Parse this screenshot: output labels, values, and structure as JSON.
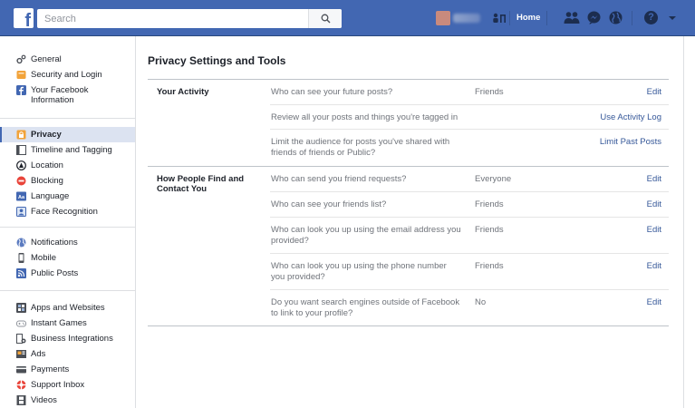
{
  "header": {
    "search_placeholder": "Search",
    "home_label": "Home",
    "brand_color": "#4267b2"
  },
  "sidebar": {
    "groups": [
      {
        "items": [
          {
            "label": "General",
            "icon": "gears-icon"
          },
          {
            "label": "Security and Login",
            "icon": "badge-icon"
          },
          {
            "label": "Your Facebook Information",
            "icon": "facebook-icon"
          }
        ]
      },
      {
        "items": [
          {
            "label": "Privacy",
            "icon": "lock-icon",
            "active": true
          },
          {
            "label": "Timeline and Tagging",
            "icon": "timeline-icon"
          },
          {
            "label": "Location",
            "icon": "location-icon"
          },
          {
            "label": "Blocking",
            "icon": "blocking-icon"
          },
          {
            "label": "Language",
            "icon": "language-icon"
          },
          {
            "label": "Face Recognition",
            "icon": "face-icon"
          }
        ]
      },
      {
        "items": [
          {
            "label": "Notifications",
            "icon": "globe-icon"
          },
          {
            "label": "Mobile",
            "icon": "mobile-icon"
          },
          {
            "label": "Public Posts",
            "icon": "rss-icon"
          }
        ]
      },
      {
        "items": [
          {
            "label": "Apps and Websites",
            "icon": "apps-icon"
          },
          {
            "label": "Instant Games",
            "icon": "gamepad-icon"
          },
          {
            "label": "Business Integrations",
            "icon": "business-icon"
          },
          {
            "label": "Ads",
            "icon": "ads-icon"
          },
          {
            "label": "Payments",
            "icon": "card-icon"
          },
          {
            "label": "Support Inbox",
            "icon": "lifebuoy-icon"
          },
          {
            "label": "Videos",
            "icon": "film-icon"
          }
        ]
      }
    ]
  },
  "main": {
    "title": "Privacy Settings and Tools",
    "sections": [
      {
        "title": "Your Activity",
        "rows": [
          {
            "question": "Who can see your future posts?",
            "value": "Friends",
            "action": "Edit"
          },
          {
            "question": "Review all your posts and things you're tagged in",
            "value": "",
            "action": "Use Activity Log"
          },
          {
            "question": "Limit the audience for posts you've shared with friends of friends or Public?",
            "value": "",
            "action": "Limit Past Posts"
          }
        ]
      },
      {
        "title": "How People Find and Contact You",
        "rows": [
          {
            "question": "Who can send you friend requests?",
            "value": "Everyone",
            "action": "Edit"
          },
          {
            "question": "Who can see your friends list?",
            "value": "Friends",
            "action": "Edit"
          },
          {
            "question": "Who can look you up using the email address you provided?",
            "value": "Friends",
            "action": "Edit"
          },
          {
            "question": "Who can look you up using the phone number you provided?",
            "value": "Friends",
            "action": "Edit"
          },
          {
            "question": "Do you want search engines outside of Facebook to link to your profile?",
            "value": "No",
            "action": "Edit"
          }
        ]
      }
    ]
  }
}
